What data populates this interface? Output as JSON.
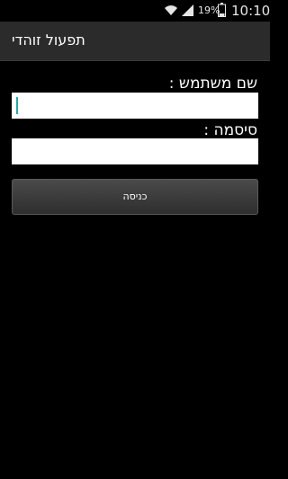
{
  "status_bar": {
    "battery_percent": "19%",
    "time": "10:10",
    "icons": [
      "wifi-icon",
      "signal-icon",
      "battery-icon"
    ]
  },
  "action_bar": {
    "title": "תפעול זוהדי"
  },
  "form": {
    "username_label": "שם משתמש :",
    "username_value": "",
    "password_label": "סיסמה :",
    "password_value": "",
    "login_button_label": "כניסה"
  },
  "colors": {
    "background": "#000000",
    "action_bar": "#2b2b2b",
    "cursor_accent": "#2aa7a7",
    "input_background": "#ffffff"
  }
}
